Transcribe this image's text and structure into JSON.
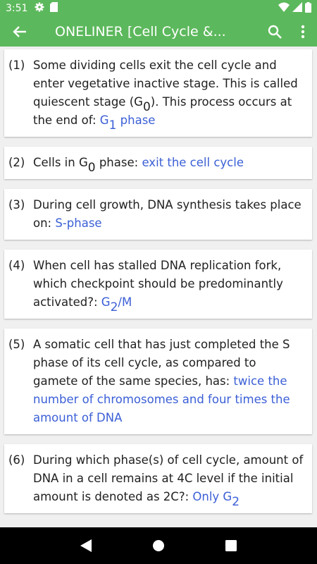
{
  "status": {
    "time": "3:51"
  },
  "app_bar": {
    "title": "ONELINER [Cell Cycle &..."
  },
  "items": [
    {
      "num": "(1)",
      "q": "Some dividing cells exit the cell cycle and enter vegetative inactive stage. This is called quiescent stage (G",
      "q_sub": "0",
      "q_tail": "). This process occurs at the end of: ",
      "a": "G",
      "a_sub": "1",
      "a_tail": " phase"
    },
    {
      "num": "(2)",
      "q": "Cells in G",
      "q_sub": "0",
      "q_tail": " phase: ",
      "a": "exit the cell cycle"
    },
    {
      "num": "(3)",
      "q": "During cell growth, DNA synthesis takes place on: ",
      "a": "S-phase"
    },
    {
      "num": "(4)",
      "q": "When cell has stalled DNA replication fork, which checkpoint should be predominantly activated?: ",
      "a": "G",
      "a_sub": "2",
      "a_tail": "/M"
    },
    {
      "num": "(5)",
      "q": "A somatic cell that has just completed the S phase of its cell cycle, as compared to gamete of the same species, has: ",
      "a": "twice the number of chromosomes and four times the amount of DNA"
    },
    {
      "num": "(6)",
      "q": "During which phase(s) of cell cycle, amount of DNA in a cell remains at 4C level if the initial amount is denoted as 2C?: ",
      "a": "Only G",
      "a_sub": "2"
    }
  ],
  "icons": {
    "status_left": [
      "settings-icon",
      "sd-card-icon"
    ],
    "status_right": [
      "wifi-icon",
      "signal-icon",
      "battery-icon"
    ],
    "app_bar": [
      "back-arrow-icon",
      "search-icon",
      "more-vert-icon"
    ],
    "nav": [
      "nav-back-icon",
      "nav-home-icon",
      "nav-recents-icon"
    ]
  },
  "colors": {
    "primary": "#5cb85c",
    "answer": "#3b5fd6"
  }
}
